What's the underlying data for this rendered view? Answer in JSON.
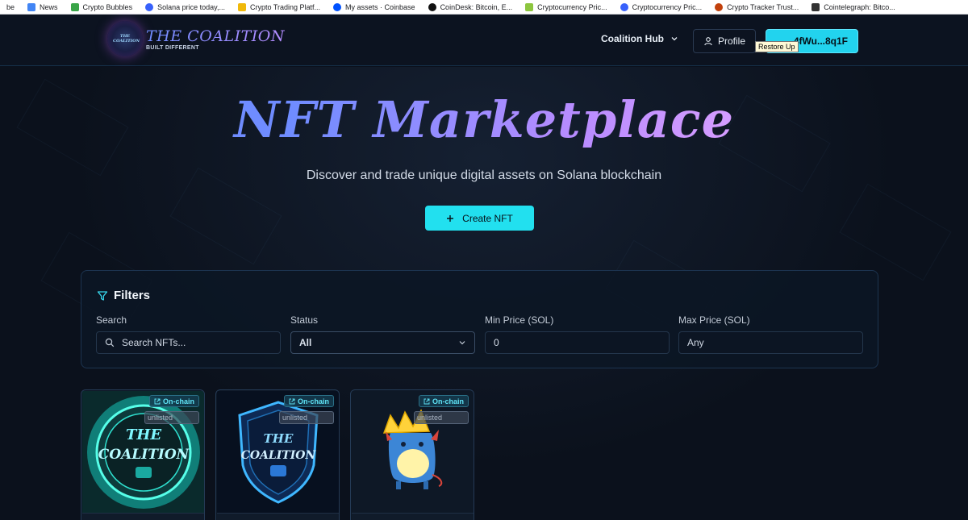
{
  "bookmarks": [
    {
      "label": "be",
      "color": "#ffffff"
    },
    {
      "label": "News",
      "color": "#4285f4"
    },
    {
      "label": "Crypto Bubbles",
      "color": "#3aa548"
    },
    {
      "label": "Solana price today,...",
      "color": "#3861fb"
    },
    {
      "label": "Crypto Trading Platf...",
      "color": "#f0b90b"
    },
    {
      "label": "My assets · Coinbase",
      "color": "#0052ff"
    },
    {
      "label": "CoinDesk: Bitcoin, E...",
      "color": "#111111"
    },
    {
      "label": "Cryptocurrency Pric...",
      "color": "#8dc63f"
    },
    {
      "label": "Cryptocurrency Pric...",
      "color": "#3861fb"
    },
    {
      "label": "Crypto Tracker Trust...",
      "color": "#c2410c"
    },
    {
      "label": "Cointelegraph: Bitco...",
      "color": "#333333"
    }
  ],
  "header": {
    "logo_badge": "THE COALITION",
    "brand_title": "THE COALITION",
    "brand_tagline": "BUILT DIFFERENT",
    "hub_label": "Coalition Hub",
    "profile_label": "Profile",
    "wallet_label": "4fWu...8q1F",
    "tooltip": "Restore Up"
  },
  "hero": {
    "title": "NFT Marketplace",
    "subtitle": "Discover and trade unique digital assets on Solana blockchain",
    "create_label": "Create NFT"
  },
  "filters": {
    "title": "Filters",
    "search_label": "Search",
    "search_placeholder": "Search NFTs...",
    "status_label": "Status",
    "status_value": "All",
    "min_label": "Min Price (SOL)",
    "min_value": "0",
    "max_label": "Max Price (SOL)",
    "max_placeholder": "Any"
  },
  "cards": [
    {
      "chain_badge": "On-chain",
      "status_badge": "unlisted",
      "art_text_1": "THE",
      "art_text_2": "COALITION"
    },
    {
      "chain_badge": "On-chain",
      "status_badge": "unlisted",
      "art_text_1": "THE",
      "art_text_2": "COALITION"
    },
    {
      "chain_badge": "On-chain",
      "status_badge": "unlisted"
    }
  ],
  "colors": {
    "accent": "#22e0ef",
    "background": "#0b111c",
    "title_gradient_start": "#6f8cff",
    "title_gradient_end": "#d49cff"
  }
}
